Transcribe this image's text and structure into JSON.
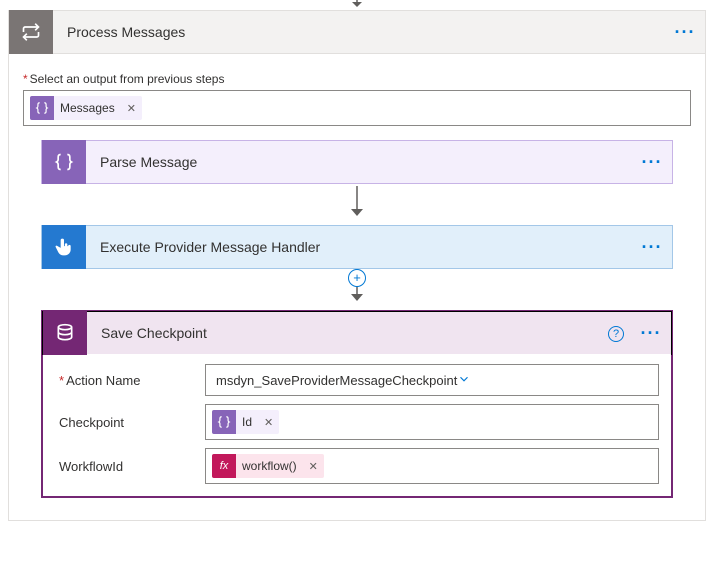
{
  "top_step": {
    "title": "Process Messages"
  },
  "output_section": {
    "label": "Select an output from previous steps",
    "chip_label": "Messages"
  },
  "steps": {
    "parse": {
      "title": "Parse Message"
    },
    "execute": {
      "title": "Execute Provider Message Handler"
    },
    "save": {
      "title": "Save Checkpoint"
    }
  },
  "save_panel": {
    "rows": {
      "action": {
        "label": "Action Name",
        "value": "msdyn_SaveProviderMessageCheckpoint"
      },
      "checkpoint": {
        "label": "Checkpoint",
        "chip_label": "Id"
      },
      "workflow": {
        "label": "WorkflowId",
        "chip_label": "workflow()"
      }
    }
  },
  "glyphs": {
    "ellipsis": "···",
    "remove": "✕",
    "help": "?",
    "plus": "+",
    "fx": "fx"
  }
}
